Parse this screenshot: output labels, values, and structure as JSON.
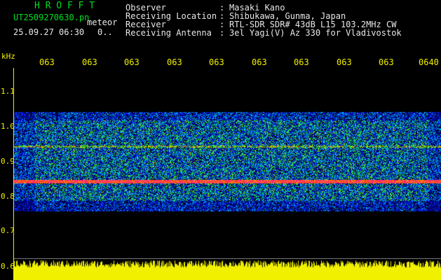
{
  "header": {
    "logo": "H R O F F T",
    "filename": "UT2509270630.pn",
    "tag": "meteor",
    "datetime": "25.09.27 06:30",
    "count": "0.."
  },
  "info": [
    {
      "label": "Observer",
      "value": "Masaki Kano"
    },
    {
      "label": "Receiving Location",
      "value": "Shibukawa, Gunma, Japan"
    },
    {
      "label": "Receiver",
      "value": "RTL-SDR SDR# 43dB L15 103.2MHz CW"
    },
    {
      "label": "Receiving Antenna",
      "value": "3el Yagi(V) Az 330 for Vladivostok"
    }
  ],
  "axis": {
    "unit": "kHz",
    "time_ticks": [
      "063",
      "063",
      "063",
      "063",
      "063",
      "063",
      "063",
      "063",
      "063",
      "0640"
    ],
    "freq_ticks": [
      "1.1",
      "1.0",
      "0.9",
      "0.8",
      "0.7",
      "0.6"
    ]
  },
  "colors": {
    "background": "#000000",
    "title": "#00e020",
    "text": "#e8e8e8",
    "axis": "#f0f000"
  }
}
